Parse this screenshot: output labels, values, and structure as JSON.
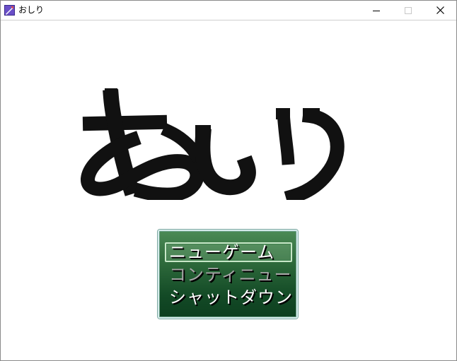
{
  "window": {
    "title": "おしり",
    "controls": {
      "minimize": "minimize-icon",
      "maximize": "maximize-icon",
      "close": "close-icon"
    }
  },
  "game": {
    "logo_text": "おしり",
    "menu": {
      "items": [
        "ニューゲーム",
        "コンティニュー",
        "シャットダウン"
      ],
      "selected_index": 0,
      "disabled_index": 1
    }
  },
  "colors": {
    "logo": "#111111",
    "menu_top": "#4b8a55",
    "menu_bottom": "#0d3f1f",
    "menu_border": "#d6ecec",
    "item_enabled": "#ffffff",
    "item_disabled": "#a7a7a7"
  }
}
